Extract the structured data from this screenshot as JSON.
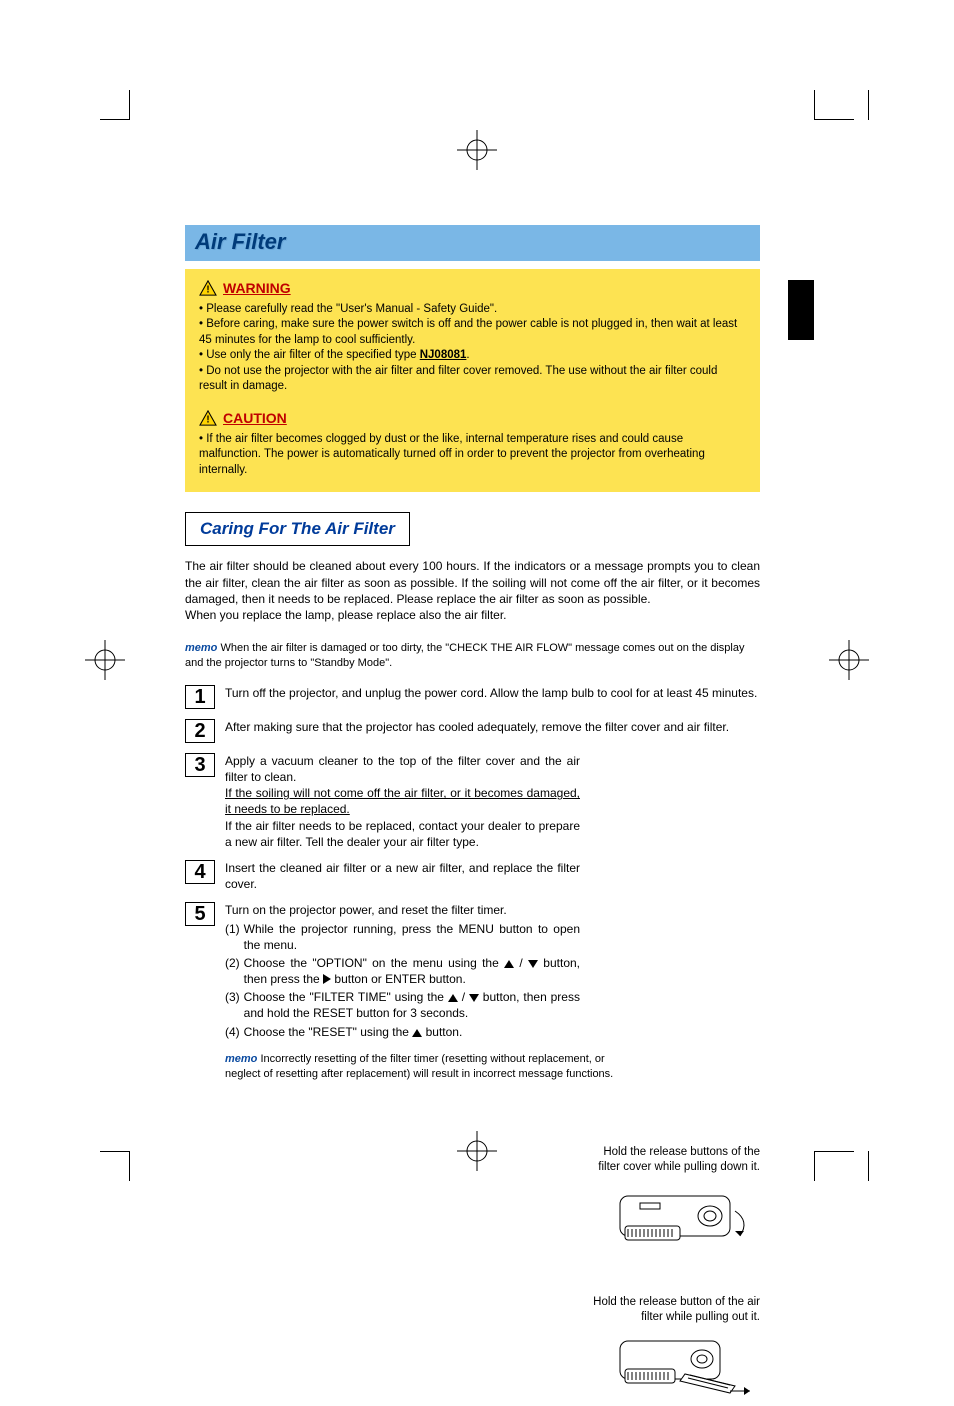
{
  "title": "Air Filter",
  "warning": {
    "label": "WARNING",
    "text_before": "• Please carefully read the \"User's Manual - Safety Guide\".\n• Before caring, make sure the power switch is off and the power cable is not plugged in, then wait at least 45 minutes for the lamp to cool sufficiently.\n• Use only the air filter of the specified type ",
    "part_no": "NJ08081",
    "text_after": ".\n• Do not use the projector with the air filter and filter cover removed. The use without the air filter could result in damage."
  },
  "caution": {
    "label": "CAUTION",
    "text": "• If the air filter becomes clogged by dust or the like, internal temperature rises and could cause malfunction. The power is automatically turned off in order to prevent the projector from overheating internally."
  },
  "subsection": "Caring For The Air Filter",
  "intro": "The air filter should be cleaned about every 100 hours. If the indicators or a message prompts you to clean the air filter, clean the air filter as soon as possible. If the soiling will not come off the air filter, or it becomes damaged, then it needs to be replaced. Please replace the air filter as soon as possible.\nWhen you replace the lamp, please replace also the air filter.",
  "memo1": {
    "label": "memo",
    "text": "When the air filter is damaged or too dirty, the \"CHECK THE AIR FLOW\" message comes out on the display and the projector turns to \"Standby Mode\"."
  },
  "steps": [
    {
      "n": "1",
      "text": "Turn off the projector, and unplug the power cord. Allow the lamp bulb to cool for at least 45 minutes."
    },
    {
      "n": "2",
      "text": "After making sure that the projector has cooled adequately, remove the filter cover and air filter."
    },
    {
      "n": "3",
      "text_a": "Apply a vacuum cleaner to the top of the filter cover and the air filter to clean.",
      "text_b": "If the soiling will not come off the air filter, or it becomes damaged, it needs to be replaced.",
      "text_c": "If the air filter needs to be replaced, contact your dealer to prepare a new air filter. Tell the dealer your air filter type."
    },
    {
      "n": "4",
      "text": "Insert the cleaned air filter or a new air filter, and replace the filter cover."
    },
    {
      "n": "5",
      "text": "Turn on the projector power, and reset the filter timer.",
      "subs": [
        {
          "n": "(1)",
          "t": "While the projector running, press the MENU button to open the menu."
        },
        {
          "n": "(2)",
          "t_before": "Choose the \"OPTION\" on the menu using the ",
          "t_mid": " / ",
          "t_after": " button, then press the ",
          "t_end": " button or ENTER button."
        },
        {
          "n": "(3)",
          "t_before": "Choose the \"FILTER TIME\" using the ",
          "t_mid": " / ",
          "t_after": " button, then press and hold the RESET button for 3 seconds."
        },
        {
          "n": "(4)",
          "t_before": "Choose the \"RESET\" using the ",
          "t_after": " button."
        }
      ]
    }
  ],
  "memo2": {
    "label": "memo",
    "text": "Incorrectly resetting of the filter timer (resetting without replacement, or neglect of resetting after replacement) will result in incorrect message functions."
  },
  "fig1_caption": "Hold the release buttons of the filter cover while pulling down it.",
  "fig2_caption": "Hold the release button of the air filter while pulling out it."
}
